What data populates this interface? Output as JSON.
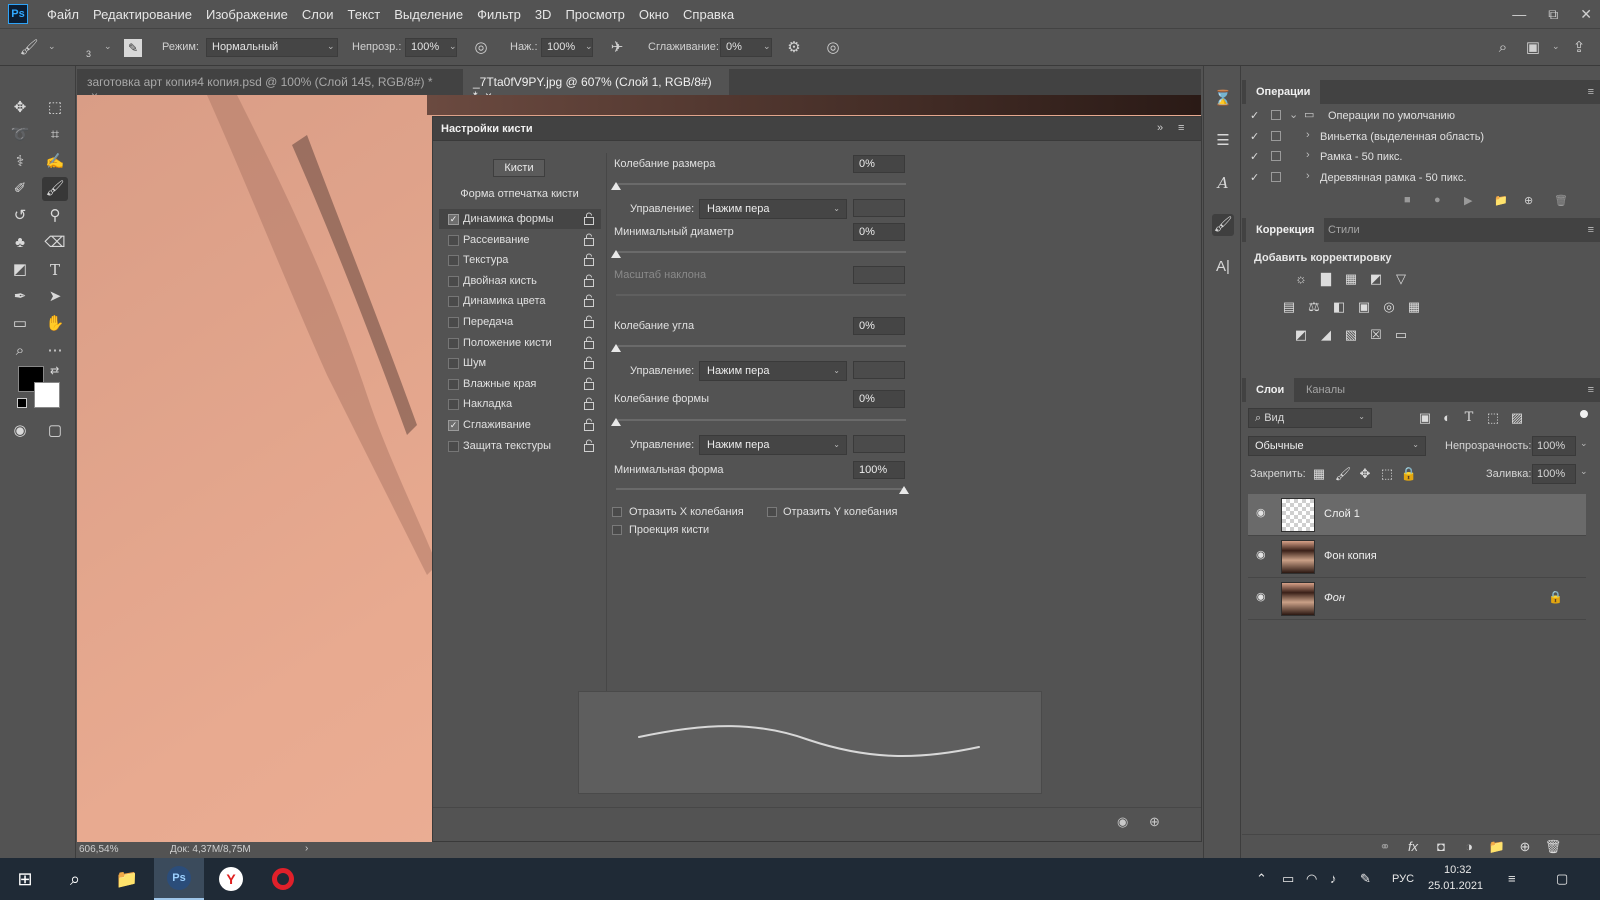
{
  "menubar": {
    "logo": "Ps",
    "items": [
      "Файл",
      "Редактирование",
      "Изображение",
      "Слои",
      "Текст",
      "Выделение",
      "Фильтр",
      "3D",
      "Просмотр",
      "Окно",
      "Справка"
    ]
  },
  "options": {
    "brush_size": "3",
    "mode_label": "Режим:",
    "mode_value": "Нормальный",
    "opacity_label": "Непрозр.:",
    "opacity_value": "100%",
    "pressure_label": "Наж.:",
    "pressure_value": "100%",
    "smoothing_label": "Сглаживание:",
    "smoothing_value": "0%"
  },
  "tabs": [
    {
      "label": "заготовка арт копия4 копия.psd @ 100% (Слой 145, RGB/8#) *",
      "close": "×"
    },
    {
      "label": "_7Tta0fV9PY.jpg @ 607% (Слой 1, RGB/8#) *",
      "close": "×"
    }
  ],
  "status": {
    "zoom": "606,54%",
    "doc": "Док: 4,37M/8,75M"
  },
  "brush_panel": {
    "title": "Настройки кисти",
    "brushes_button": "Кисти",
    "tip_shape": "Форма отпечатка кисти",
    "options": [
      {
        "label": "Динамика формы",
        "checked": true
      },
      {
        "label": "Рассеивание",
        "checked": false
      },
      {
        "label": "Текстура",
        "checked": false
      },
      {
        "label": "Двойная кисть",
        "checked": false
      },
      {
        "label": "Динамика цвета",
        "checked": false
      },
      {
        "label": "Передача",
        "checked": false
      },
      {
        "label": "Положение кисти",
        "checked": false
      },
      {
        "label": "Шум",
        "checked": false
      },
      {
        "label": "Влажные края",
        "checked": false
      },
      {
        "label": "Накладка",
        "checked": false
      },
      {
        "label": "Сглаживание",
        "checked": true
      },
      {
        "label": "Защита текстуры",
        "checked": false
      }
    ],
    "size_jitter_label": "Колебание размера",
    "size_jitter_value": "0%",
    "control_label": "Управление:",
    "control_value": "Нажим пера",
    "min_diameter_label": "Минимальный диаметр",
    "min_diameter_value": "0%",
    "tilt_scale_label": "Масштаб наклона",
    "angle_jitter_label": "Колебание угла",
    "angle_jitter_value": "0%",
    "roundness_jitter_label": "Колебание формы",
    "roundness_jitter_value": "0%",
    "min_roundness_label": "Минимальная форма",
    "min_roundness_value": "100%",
    "flip_x_label": "Отразить X колебания",
    "flip_y_label": "Отразить Y колебания",
    "projection_label": "Проекция кисти"
  },
  "actions_panel": {
    "tab": "Операции",
    "rows": [
      "Операции по умолчанию",
      "Виньетка (выделенная область)",
      "Рамка - 50 пикс.",
      "Деревянная рамка - 50 пикс."
    ]
  },
  "adjustments_panel": {
    "tabs": [
      "Коррекция",
      "Стили"
    ],
    "add_label": "Добавить корректировку"
  },
  "layers_panel": {
    "tabs": [
      "Слои",
      "Каналы"
    ],
    "filter_label": "Вид",
    "blend_mode": "Обычные",
    "opacity_label": "Непрозрачность:",
    "opacity_value": "100%",
    "lock_label": "Закрепить:",
    "fill_label": "Заливка:",
    "fill_value": "100%",
    "layers": [
      {
        "name": "Слой 1",
        "selected": true
      },
      {
        "name": "Фон копия",
        "selected": false
      },
      {
        "name": "Фон",
        "selected": false
      }
    ]
  },
  "taskbar": {
    "lang": "РУС",
    "time": "10:32",
    "date": "25.01.2021"
  }
}
